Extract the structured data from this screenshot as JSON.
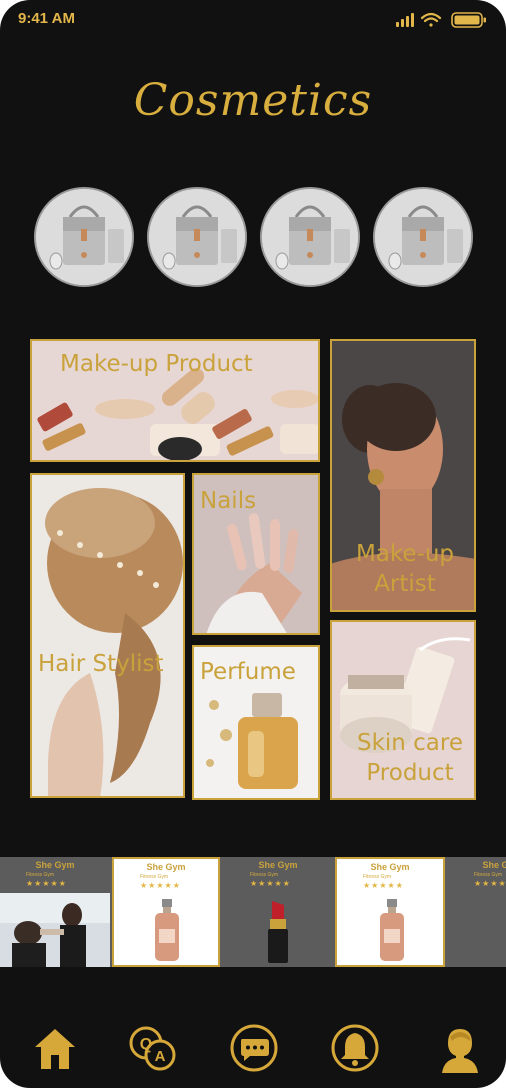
{
  "status": {
    "time": "9:41 AM"
  },
  "header": {
    "title": "Cosmetics"
  },
  "stories": [
    {
      "name": "handbag-story-1"
    },
    {
      "name": "handbag-story-2"
    },
    {
      "name": "handbag-story-3"
    },
    {
      "name": "handbag-story-4"
    }
  ],
  "categories": {
    "makeup_product": "Make-up Product",
    "makeup_artist_line1": "Make-up",
    "makeup_artist_line2": "Artist",
    "hair_stylist": "Hair Stylist",
    "nails": "Nails",
    "perfume": "Perfume",
    "skin_care_line1": "Skin care",
    "skin_care_line2": "Product"
  },
  "products": [
    {
      "name": "She Gym",
      "subtitle": "Fitness Gym",
      "rating": "★★★★★"
    },
    {
      "name": "She Gym",
      "subtitle": "Fitness Gym",
      "rating": "★★★★★"
    },
    {
      "name": "She Gym",
      "subtitle": "Fitness Gym",
      "rating": "★★★★★"
    },
    {
      "name": "She Gym",
      "subtitle": "Fitness Gym",
      "rating": "★★★★★"
    },
    {
      "name": "She Gym",
      "subtitle": "Fitness Gym",
      "rating": "★★★★★"
    }
  ],
  "nav": [
    {
      "icon": "home-icon"
    },
    {
      "icon": "qa-icon"
    },
    {
      "icon": "chat-icon"
    },
    {
      "icon": "bell-icon"
    },
    {
      "icon": "profile-icon"
    }
  ],
  "colors": {
    "gold": "#c9a23c",
    "background": "#111111",
    "strip": "#5c5c5c"
  }
}
